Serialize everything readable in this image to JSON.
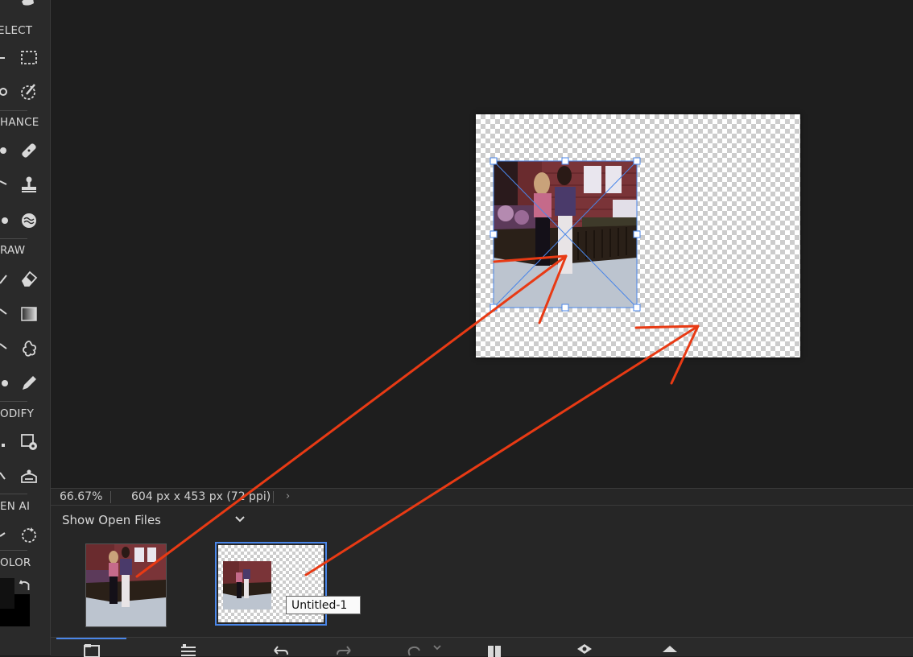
{
  "toolbar": {
    "sections": {
      "select": "ELECT",
      "enhance": "HANCE",
      "draw": "RAW",
      "modify": "ODIFY",
      "genai": "EN AI",
      "color": "OLOR"
    },
    "icons": [
      "hand-icon",
      "rectangular-marquee-icon",
      "quick-selection-icon",
      "spot-healing-icon",
      "clone-stamp-icon",
      "smart-brush-icon",
      "eraser-icon",
      "gradient-icon",
      "custom-shape-icon",
      "pencil-icon",
      "transform-settings-icon",
      "content-aware-move-icon",
      "generative-fill-icon",
      "swap-colors-icon"
    ]
  },
  "status_bar": {
    "zoom": "66.67%",
    "doc_info": "604 px x 453 px (72 ppi)",
    "chevron": "›"
  },
  "photo_bin": {
    "label": "Show Open Files",
    "tooltip": "Untitled-1",
    "thumbnails": [
      {
        "name": "photo-thumbnail"
      },
      {
        "name": "Untitled-1",
        "selected": true
      }
    ]
  },
  "colors": {
    "annotation": "#e83a14",
    "selection": "#4a86e8",
    "panel": "#262626",
    "workspace": "#1e1e1e"
  }
}
